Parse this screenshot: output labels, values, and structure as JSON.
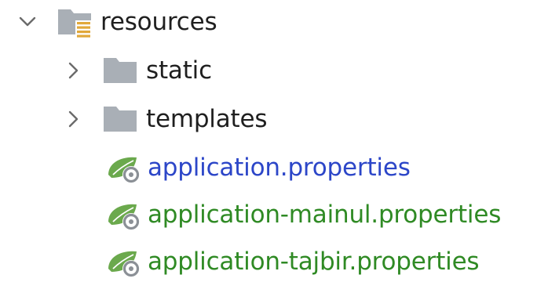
{
  "tree": {
    "root": {
      "label": "resources",
      "expanded": true,
      "icon": "resources-folder-icon"
    },
    "children": [
      {
        "label": "static",
        "type": "folder",
        "expanded": false,
        "icon": "folder-icon"
      },
      {
        "label": "templates",
        "type": "folder",
        "expanded": false,
        "icon": "folder-icon"
      },
      {
        "label": "application.properties",
        "type": "file",
        "icon": "spring-properties-icon",
        "color": "#2c46c8"
      },
      {
        "label": "application-mainul.properties",
        "type": "file",
        "icon": "spring-properties-icon",
        "color": "#2f8a24"
      },
      {
        "label": "application-tajbir.properties",
        "type": "file",
        "icon": "spring-properties-icon",
        "color": "#2f8a24"
      }
    ]
  },
  "colors": {
    "folder": "#a9afb6",
    "resources_accent": "#e1a83a",
    "spring_leaf": "#6ba94d",
    "gear": "#8b9096"
  }
}
